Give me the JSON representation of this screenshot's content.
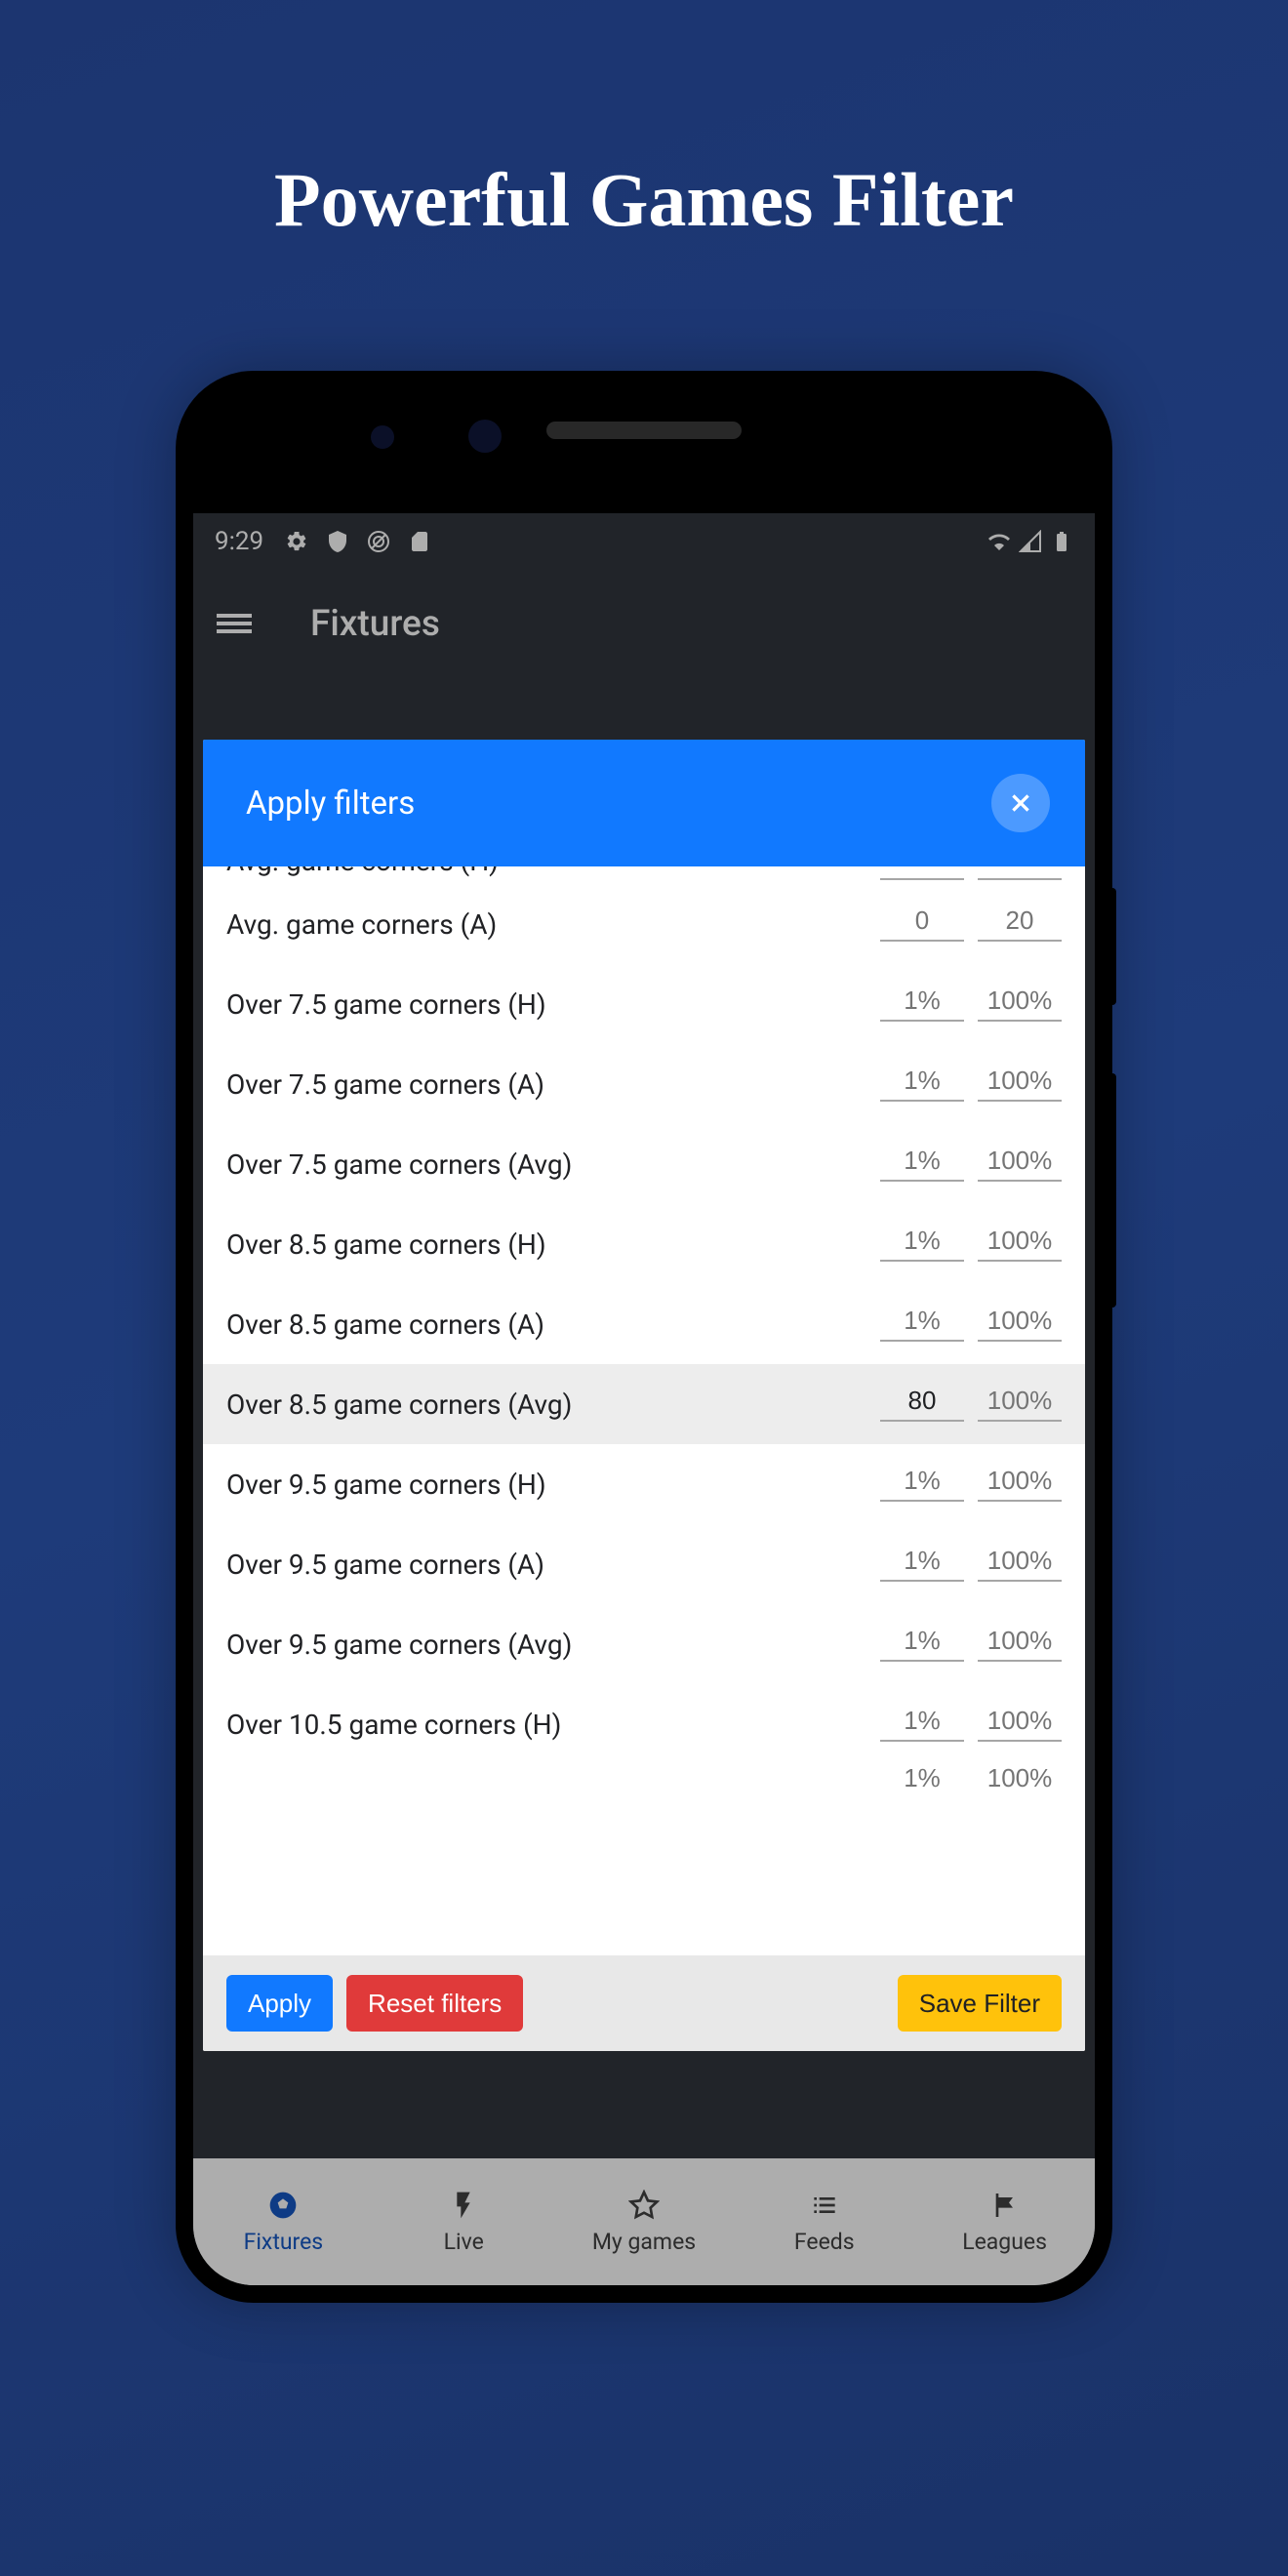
{
  "promo": {
    "title": "Powerful Games Filter"
  },
  "statusbar": {
    "time": "9:29"
  },
  "appbar": {
    "title": "Fixtures"
  },
  "dialog": {
    "title": "Apply filters",
    "buttons": {
      "apply": "Apply",
      "reset": "Reset filters",
      "save": "Save Filter"
    }
  },
  "filters": [
    {
      "label": "Avg. game corners (H)",
      "min": "",
      "max": "",
      "truncated": "top"
    },
    {
      "label": "Avg. game corners (A)",
      "min": "0",
      "max": "20",
      "min_val": false,
      "max_val": false
    },
    {
      "label": "Over 7.5 game corners (H)",
      "min": "1%",
      "max": "100%",
      "min_val": false,
      "max_val": false
    },
    {
      "label": "Over 7.5 game corners (A)",
      "min": "1%",
      "max": "100%",
      "min_val": false,
      "max_val": false
    },
    {
      "label": "Over 7.5 game corners (Avg)",
      "min": "1%",
      "max": "100%",
      "min_val": false,
      "max_val": false
    },
    {
      "label": "Over 8.5 game corners (H)",
      "min": "1%",
      "max": "100%",
      "min_val": false,
      "max_val": false
    },
    {
      "label": "Over 8.5 game corners (A)",
      "min": "1%",
      "max": "100%",
      "min_val": false,
      "max_val": false
    },
    {
      "label": "Over 8.5 game corners (Avg)",
      "min": "80",
      "max": "100%",
      "min_val": true,
      "max_val": false,
      "active": true
    },
    {
      "label": "Over 9.5 game corners (H)",
      "min": "1%",
      "max": "100%",
      "min_val": false,
      "max_val": false
    },
    {
      "label": "Over 9.5 game corners (A)",
      "min": "1%",
      "max": "100%",
      "min_val": false,
      "max_val": false
    },
    {
      "label": "Over 9.5 game corners (Avg)",
      "min": "1%",
      "max": "100%",
      "min_val": false,
      "max_val": false
    },
    {
      "label": "Over 10.5 game corners (H)",
      "min": "1%",
      "max": "100%",
      "min_val": false,
      "max_val": false
    },
    {
      "label": "",
      "min": "1%",
      "max": "100%",
      "min_val": false,
      "max_val": false,
      "truncated": "bottom"
    }
  ],
  "nav": [
    {
      "label": "Fixtures",
      "icon": "soccer",
      "active": true
    },
    {
      "label": "Live",
      "icon": "bolt"
    },
    {
      "label": "My games",
      "icon": "star"
    },
    {
      "label": "Feeds",
      "icon": "list"
    },
    {
      "label": "Leagues",
      "icon": "flag"
    }
  ]
}
